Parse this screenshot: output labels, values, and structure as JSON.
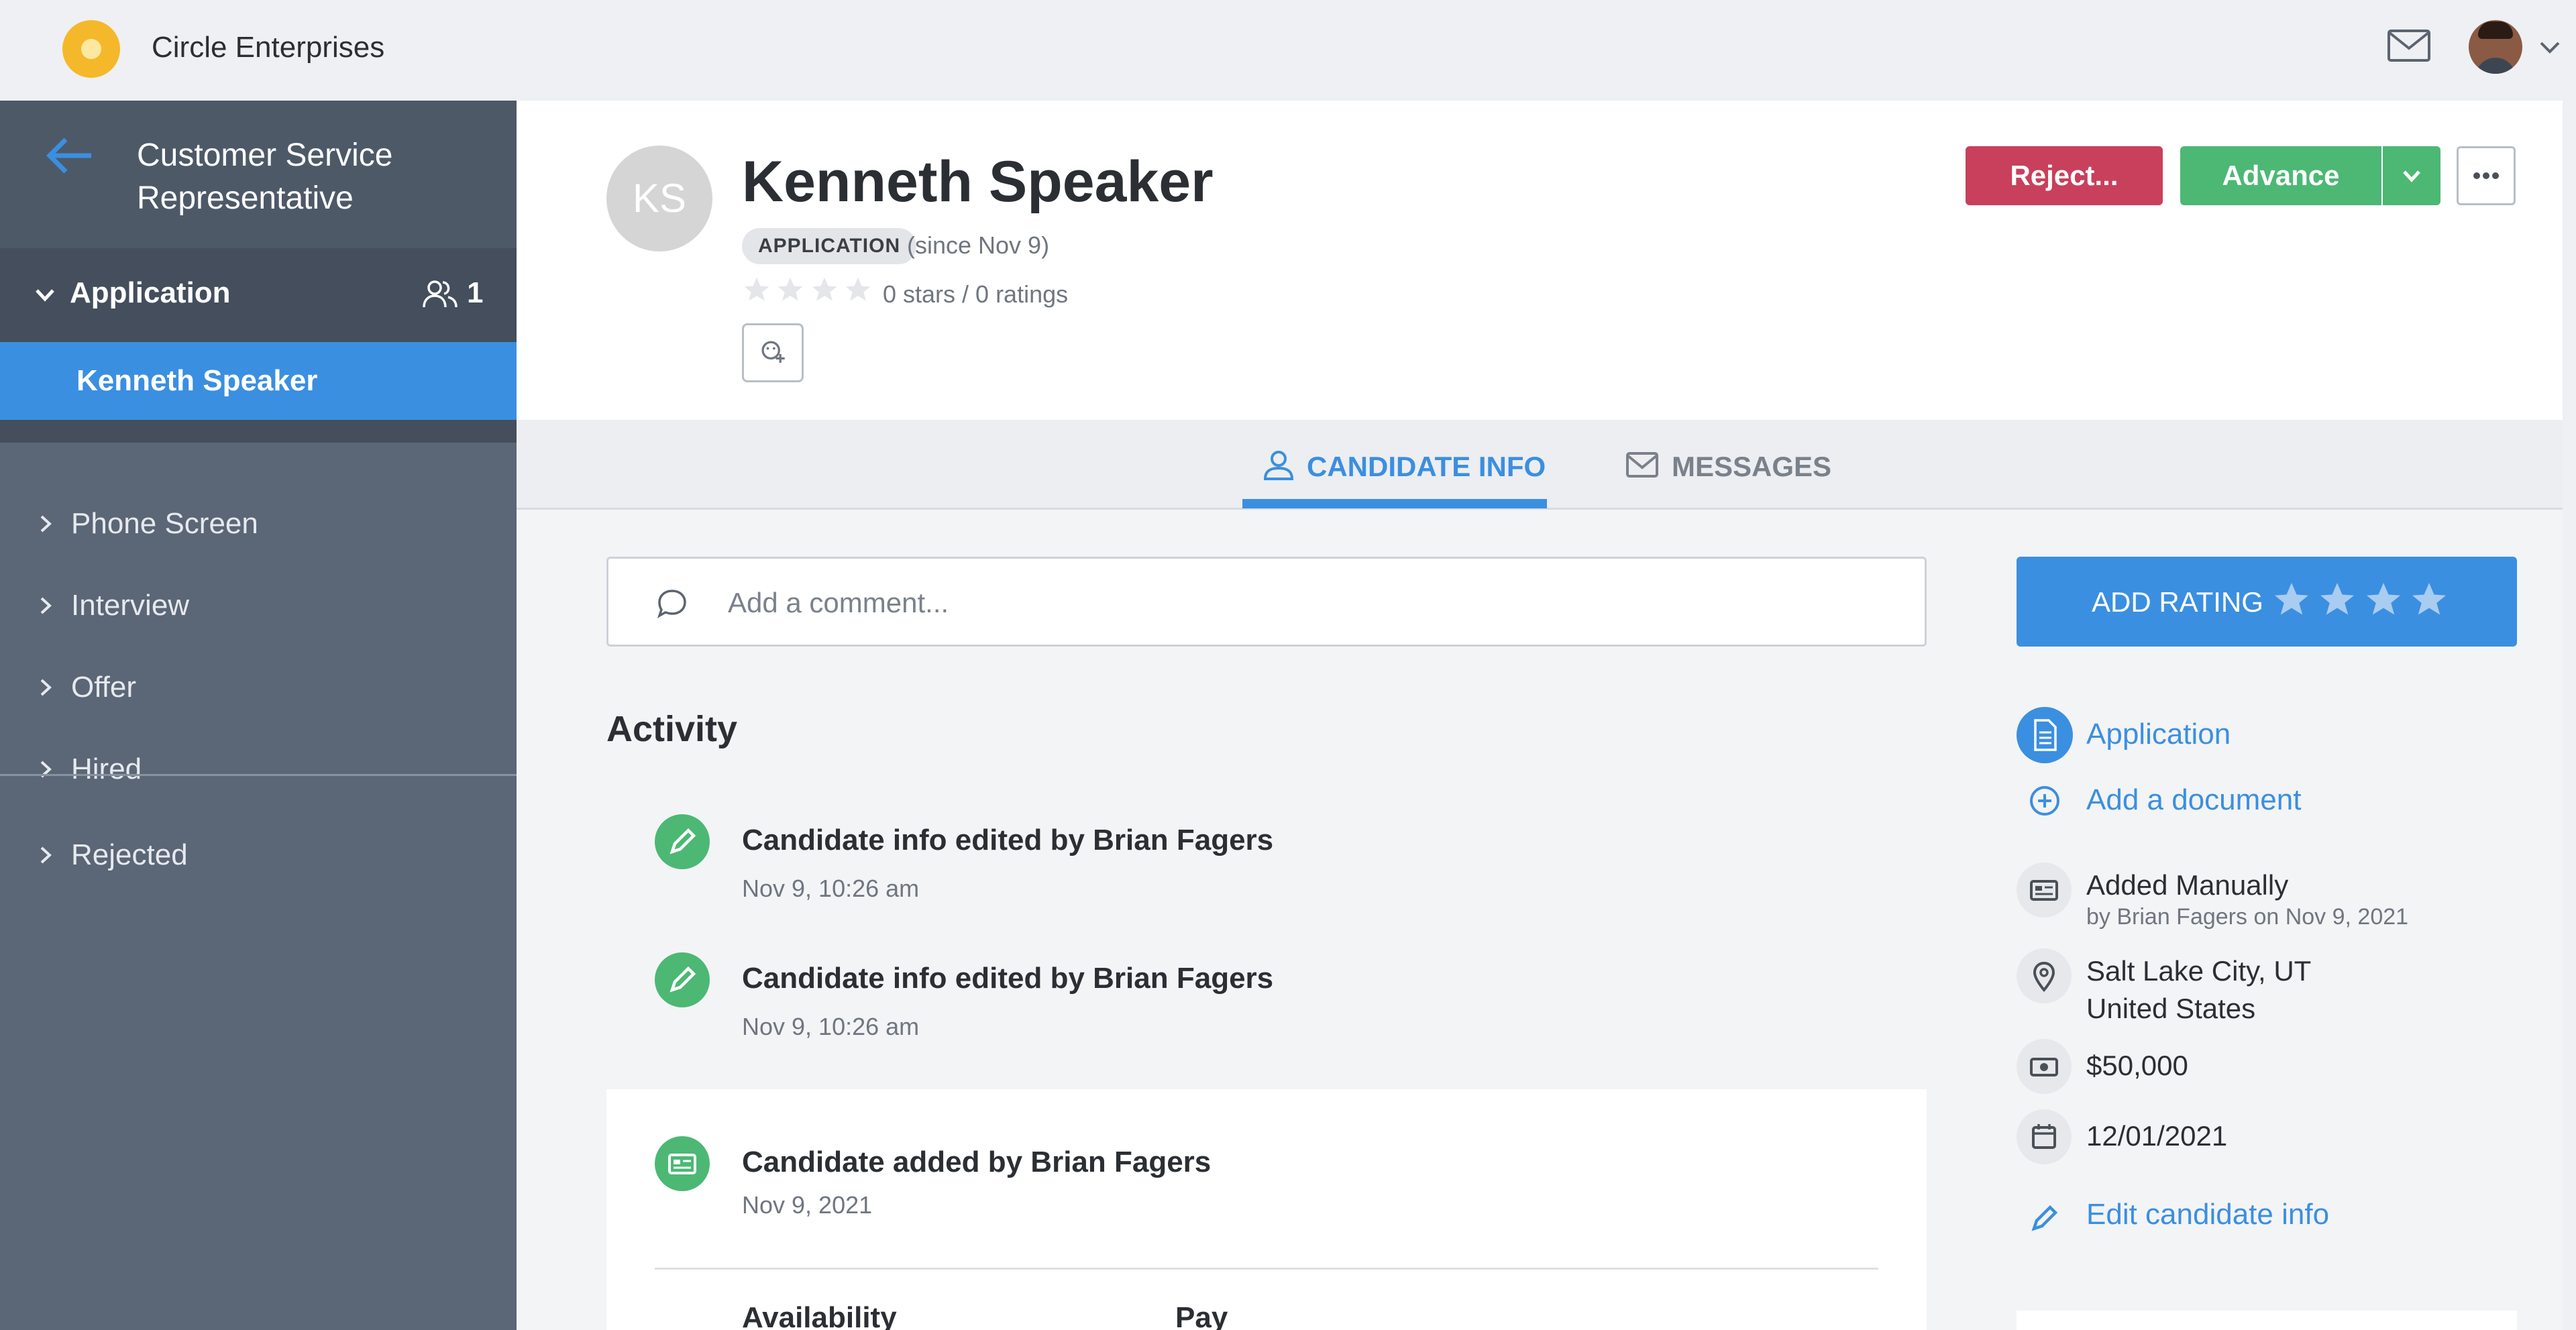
{
  "app": {
    "company": "Circle Enterprises"
  },
  "sidebar": {
    "job_title": "Customer Service Representative",
    "current_stage": {
      "label": "Application",
      "count": "1"
    },
    "current_candidate": "Kenneth Speaker",
    "stages": [
      "Phone Screen",
      "Interview",
      "Offer",
      "Hired",
      "Rejected"
    ]
  },
  "candidate": {
    "initials": "KS",
    "name": "Kenneth Speaker",
    "stage_badge": "APPLICATION",
    "since": "(since Nov 9)",
    "ratings_text": "0 stars / 0 ratings",
    "rating": 0
  },
  "actions": {
    "reject": "Reject...",
    "advance": "Advance"
  },
  "tabs": [
    {
      "label": "CANDIDATE INFO",
      "active": true,
      "icon": "person-icon"
    },
    {
      "label": "MESSAGES",
      "active": false,
      "icon": "envelope-icon"
    }
  ],
  "comment": {
    "placeholder": "Add a comment..."
  },
  "activity": {
    "heading": "Activity",
    "items": [
      {
        "title": "Candidate info edited by Brian Fagers",
        "time": "Nov 9, 10:26 am",
        "icon": "pencil-icon"
      },
      {
        "title": "Candidate info edited by Brian Fagers",
        "time": "Nov 9, 10:26 am",
        "icon": "pencil-icon"
      },
      {
        "title": "Candidate added by Brian Fagers",
        "time": "Nov 9, 2021",
        "icon": "id-card-icon"
      }
    ],
    "card_columns": [
      "Availability",
      "Pay"
    ]
  },
  "right_panel": {
    "add_rating": "ADD RATING",
    "application_link": "Application",
    "add_document": "Add a document",
    "source": {
      "title": "Added Manually",
      "sub": "by Brian Fagers on Nov 9, 2021"
    },
    "location": {
      "city": "Salt Lake City, UT",
      "country": "United States"
    },
    "salary": "$50,000",
    "date": "12/01/2021",
    "edit_link": "Edit candidate info"
  },
  "colors": {
    "accent": "#3b8fe0",
    "reject": "#c8405c",
    "advance": "#4cb874",
    "sidebar": "#5b6676"
  }
}
